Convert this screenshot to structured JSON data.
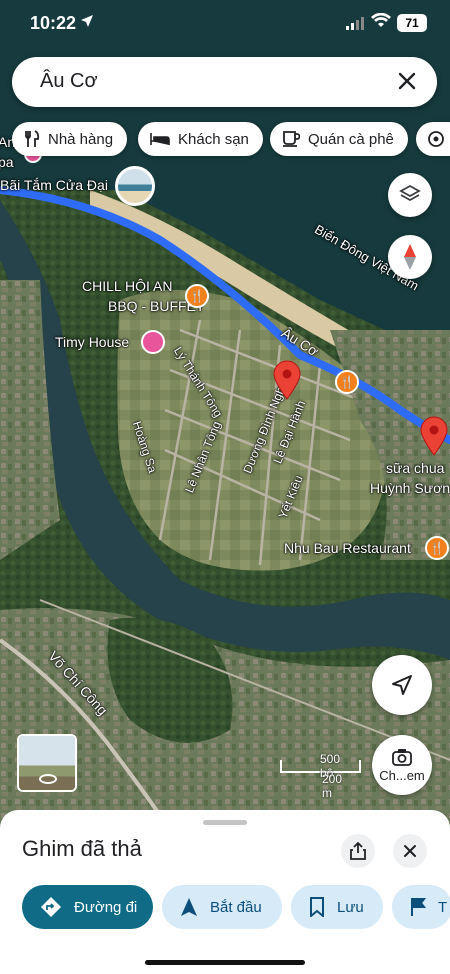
{
  "status": {
    "time": "10:22",
    "battery": "71"
  },
  "search": {
    "query": "Âu Cơ"
  },
  "chips": [
    {
      "label": "Nhà hàng",
      "icon": "fork-knife-icon"
    },
    {
      "label": "Khách sạn",
      "icon": "bed-icon"
    },
    {
      "label": "Quán cà phê",
      "icon": "coffee-cup-icon"
    }
  ],
  "map": {
    "labels": {
      "beach": "Bãi Tắm Cửa Đại",
      "sea": "Biển Đông Việt Nam",
      "chill_line1": "CHILL HỘI AN",
      "chill_line2": "BBQ - BUFFET",
      "timy": "Timy House",
      "sua_chua_1": "sữa chua",
      "sua_chua_2": "Huỳnh Sươn",
      "nhu_bau": "Nhu Bau Restaurant",
      "edge_an": "An",
      "edge_pa": "pa"
    },
    "streets": {
      "au_co": "Âu Cơ",
      "ly_thanh_tong": "Lý Thánh Tông",
      "hoang_sa": "Hoàng Sa",
      "le_nhan_tong": "Lê Nhân Tông",
      "duong_dinh_nghe": "Dương Đình Nghệ",
      "le_dai_hanh": "Lê Đại Hành",
      "yet_kieu": "Yết Kiêu",
      "vo_chi_cong": "Võ Chí Công"
    },
    "scale": {
      "feet": "500 bộ",
      "meters": "200 m"
    },
    "streetview_label": "Ch...em",
    "route_color": "#2f6cf6",
    "pin_color": "#ea4335",
    "poi_orange": "#f2811d",
    "poi_pink": "#e8559a"
  },
  "sheet": {
    "title": "Ghim đã thả",
    "actions": [
      {
        "label": "Đường đi",
        "icon": "directions-icon"
      },
      {
        "label": "Bắt đầu",
        "icon": "navigation-arrow-icon"
      },
      {
        "label": "Lưu",
        "icon": "bookmark-icon"
      },
      {
        "label": "T",
        "icon": "flag-icon"
      }
    ]
  }
}
